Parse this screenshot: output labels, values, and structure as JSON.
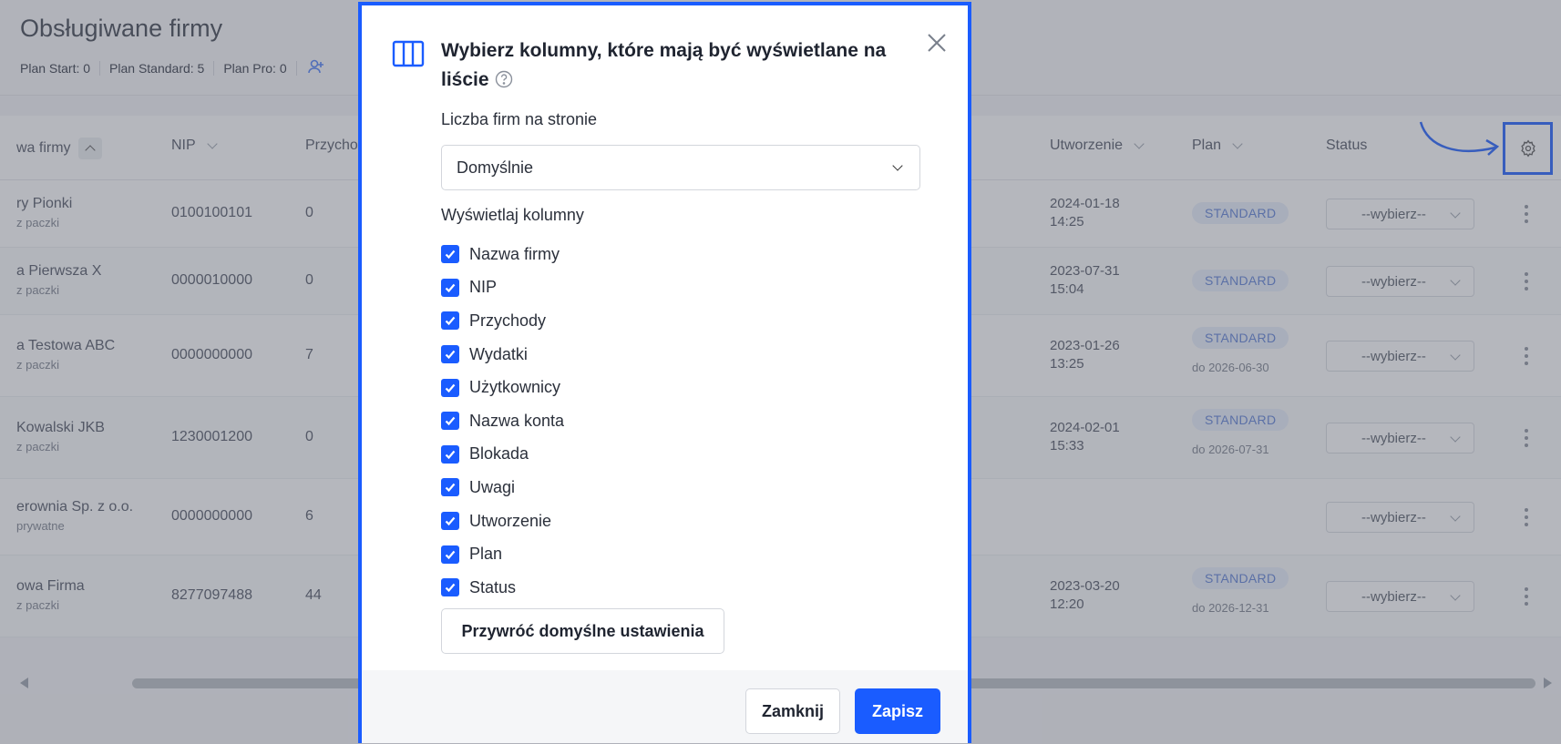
{
  "page": {
    "title": "Obsługiwane firmy",
    "plan_summary": [
      "Plan Start: 0",
      "Plan Standard: 5",
      "Plan Pro: 0"
    ]
  },
  "table": {
    "headers": {
      "name": "wa firmy",
      "nip": "NIP",
      "income": "Przycho",
      "created": "Utworzenie",
      "plan": "Plan",
      "status": "Status"
    },
    "rows": [
      {
        "name": "ry Pionki",
        "sub": "z paczki",
        "nip": "0100100101",
        "income": "0",
        "created_date": "2024-01-18",
        "created_time": "14:25",
        "plan": "STANDARD",
        "plan_until": "",
        "status": "--wybierz--"
      },
      {
        "name": "a Pierwsza X",
        "sub": "z paczki",
        "nip": "0000010000",
        "income": "0",
        "created_date": "2023-07-31",
        "created_time": "15:04",
        "plan": "STANDARD",
        "plan_until": "",
        "status": "--wybierz--"
      },
      {
        "name": "a Testowa ABC",
        "sub": "z paczki",
        "nip": "0000000000",
        "income": "7",
        "created_date": "2023-01-26",
        "created_time": "13:25",
        "plan": "STANDARD",
        "plan_until": "do 2026-06-30",
        "status": "--wybierz--"
      },
      {
        "name": "Kowalski JKB",
        "sub": "z paczki",
        "nip": "1230001200",
        "income": "0",
        "created_date": "2024-02-01",
        "created_time": "15:33",
        "plan": "STANDARD",
        "plan_until": "do 2026-07-31",
        "status": "--wybierz--"
      },
      {
        "name": "erownia Sp. z o.o.",
        "sub": "prywatne",
        "nip": "0000000000",
        "income": "6",
        "created_date": "",
        "created_time": "",
        "plan": "",
        "plan_until": "",
        "status": "--wybierz--"
      },
      {
        "name": "owa Firma",
        "sub": "z paczki",
        "nip": "8277097488",
        "income": "44",
        "created_date": "2023-03-20",
        "created_time": "12:20",
        "plan": "STANDARD",
        "plan_until": "do 2026-12-31",
        "status": "--wybierz--"
      }
    ]
  },
  "modal": {
    "title": "Wybierz kolumny, które mają być wyświetlane na liście",
    "per_page_label": "Liczba firm na stronie",
    "per_page_value": "Domyślnie",
    "columns_label": "Wyświetlaj kolumny",
    "columns": [
      "Nazwa firmy",
      "NIP",
      "Przychody",
      "Wydatki",
      "Użytkownicy",
      "Nazwa konta",
      "Blokada",
      "Uwagi",
      "Utworzenie",
      "Plan",
      "Status"
    ],
    "reset_label": "Przywróć domyślne ustawienia",
    "close_label": "Zamknij",
    "save_label": "Zapisz"
  },
  "colors": {
    "accent": "#1a5cff",
    "badge_text": "#5b7fd6",
    "badge_bg": "#e8eefb"
  },
  "icons": [
    "add-user-icon",
    "sort-up-icon",
    "chevron-down-icon",
    "gear-icon",
    "kebab-menu-icon",
    "columns-icon",
    "help-icon",
    "close-icon",
    "check-icon"
  ]
}
